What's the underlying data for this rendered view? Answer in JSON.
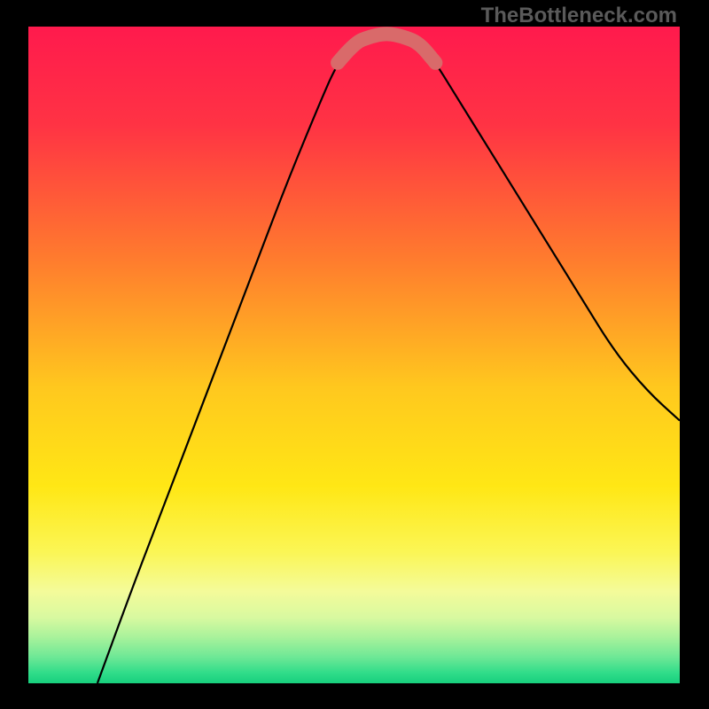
{
  "watermark": "TheBottleneck.com",
  "chart_data": {
    "type": "line",
    "title": "",
    "xlabel": "",
    "ylabel": "",
    "xlim": [
      0,
      735
    ],
    "ylim": [
      0,
      741
    ],
    "x_is_percent_of_width": true,
    "y_is_percent_of_height": true,
    "series": [
      {
        "name": "bottleneck-curve",
        "x_pct": [
          0.106,
          0.15,
          0.2,
          0.25,
          0.3,
          0.35,
          0.4,
          0.45,
          0.475,
          0.5,
          0.525,
          0.55,
          0.575,
          0.6,
          0.625,
          0.65,
          0.7,
          0.75,
          0.8,
          0.85,
          0.9,
          0.95,
          1.0
        ],
        "y_pct": [
          0.0,
          0.12,
          0.25,
          0.38,
          0.51,
          0.64,
          0.77,
          0.89,
          0.945,
          0.975,
          0.985,
          0.99,
          0.985,
          0.975,
          0.945,
          0.905,
          0.825,
          0.745,
          0.665,
          0.585,
          0.505,
          0.445,
          0.4
        ]
      },
      {
        "name": "optimal-highlight",
        "x_pct": [
          0.475,
          0.5,
          0.525,
          0.55,
          0.575,
          0.6,
          0.625
        ],
        "y_pct": [
          0.945,
          0.975,
          0.985,
          0.99,
          0.985,
          0.975,
          0.945
        ]
      }
    ],
    "background_gradient": {
      "stops": [
        {
          "pos": 0.0,
          "color": "#ff1a4d"
        },
        {
          "pos": 0.15,
          "color": "#ff3344"
        },
        {
          "pos": 0.35,
          "color": "#ff7a2e"
        },
        {
          "pos": 0.55,
          "color": "#ffc81e"
        },
        {
          "pos": 0.7,
          "color": "#ffe715"
        },
        {
          "pos": 0.8,
          "color": "#fbf655"
        },
        {
          "pos": 0.86,
          "color": "#f4fb9a"
        },
        {
          "pos": 0.9,
          "color": "#d8f9a0"
        },
        {
          "pos": 0.93,
          "color": "#a8f29b"
        },
        {
          "pos": 0.96,
          "color": "#6ee896"
        },
        {
          "pos": 0.985,
          "color": "#2edc89"
        },
        {
          "pos": 1.0,
          "color": "#18cf7d"
        }
      ]
    }
  }
}
